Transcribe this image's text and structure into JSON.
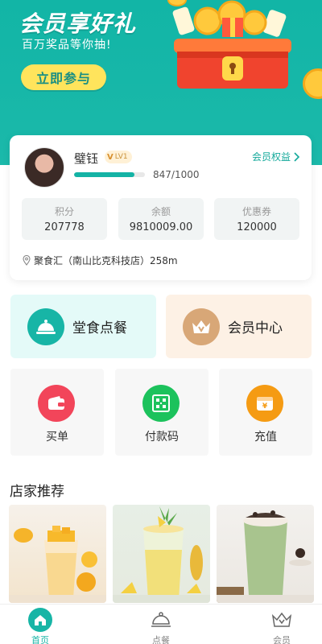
{
  "banner": {
    "title": "会员享好礼",
    "subtitle": "百万奖品等你抽!",
    "join_label": "立即参与"
  },
  "member": {
    "name": "璧钰",
    "level": "LV1",
    "level_mark": "V",
    "progress_text": "847/1000",
    "progress_fraction": 0.847,
    "benefits_label": "会员权益",
    "stats": [
      {
        "label": "积分",
        "value": "207778"
      },
      {
        "label": "余额",
        "value": "9810009.00"
      },
      {
        "label": "优惠券",
        "value": "120000"
      }
    ],
    "store": "聚食汇（南山比克科技店）258m"
  },
  "quick_actions": {
    "dine_in": "堂食点餐",
    "member_center": "会员中心"
  },
  "tiles": [
    {
      "label": "买单",
      "icon": "wallet-icon"
    },
    {
      "label": "付款码",
      "icon": "qrcode-icon"
    },
    {
      "label": "充值",
      "icon": "recharge-icon"
    }
  ],
  "recommend": {
    "title": "店家推荐"
  },
  "tabbar": {
    "home": "首页",
    "order": "点餐",
    "member": "会员"
  },
  "colors": {
    "primary": "#17b5a6",
    "accent_yellow": "#ffe45c",
    "member_gold": "#d8a777",
    "wallet_red": "#f2455a",
    "qrcode_green": "#1cc25c",
    "recharge_orange": "#f59b13"
  }
}
